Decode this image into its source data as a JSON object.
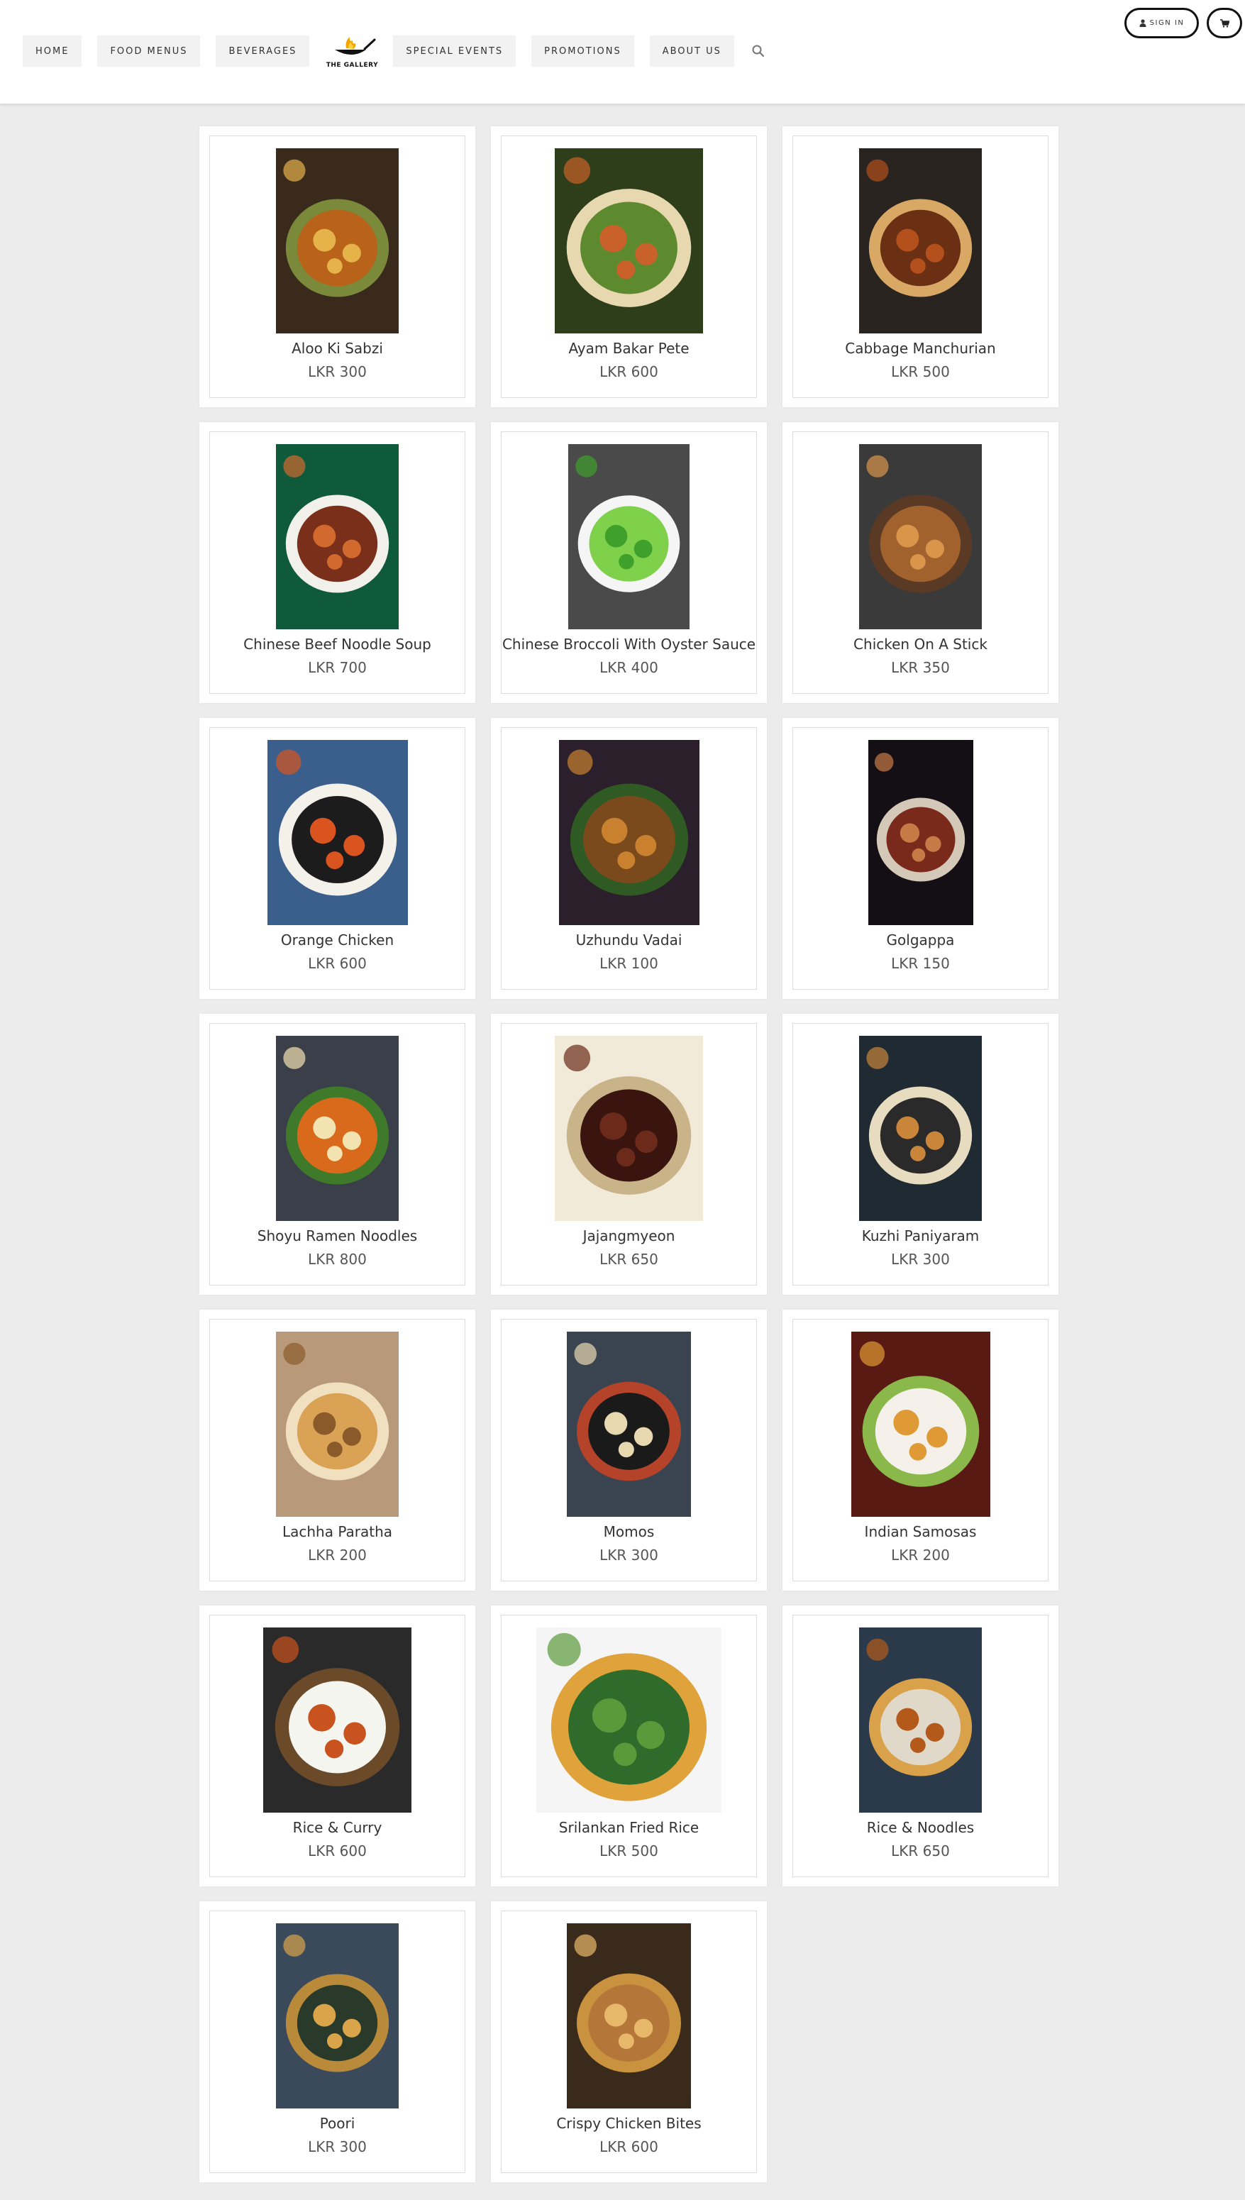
{
  "nav": {
    "items": [
      "HOME",
      "FOOD MENUS",
      "BEVERAGES",
      "SPECIAL EVENTS",
      "PROMOTIONS",
      "ABOUT US"
    ],
    "logo_text": "THE GALLERY",
    "search_icon": "search-icon"
  },
  "account": {
    "signin_label": "SIGN IN",
    "signin_icon": "user-icon",
    "cart_icon": "cart-icon"
  },
  "colors": {
    "background": "#ececec",
    "card": "#ffffff",
    "text": "#333333",
    "logo_accent": "#f0a500"
  },
  "menu_items": [
    {
      "name": "Aloo Ki Sabzi",
      "price": "LKR 300"
    },
    {
      "name": "Ayam Bakar Pete",
      "price": "LKR 600"
    },
    {
      "name": "Cabbage Manchurian",
      "price": "LKR 500"
    },
    {
      "name": "Chinese Beef Noodle Soup",
      "price": "LKR 700"
    },
    {
      "name": "Chinese Broccoli With Oyster Sauce",
      "price": "LKR 400"
    },
    {
      "name": "Chicken On A Stick",
      "price": "LKR 350"
    },
    {
      "name": "Orange Chicken",
      "price": "LKR 600"
    },
    {
      "name": "Uzhundu Vadai",
      "price": "LKR 100"
    },
    {
      "name": "Golgappa",
      "price": "LKR 150"
    },
    {
      "name": "Shoyu Ramen Noodles",
      "price": "LKR 800"
    },
    {
      "name": "Jajangmyeon",
      "price": "LKR 650"
    },
    {
      "name": "Kuzhi Paniyaram",
      "price": "LKR 300"
    },
    {
      "name": "Lachha Paratha",
      "price": "LKR 200"
    },
    {
      "name": "Momos",
      "price": "LKR 300"
    },
    {
      "name": "Indian Samosas",
      "price": "LKR 200"
    },
    {
      "name": "Rice & Curry",
      "price": "LKR 600"
    },
    {
      "name": "Srilankan Fried Rice",
      "price": "LKR 500"
    },
    {
      "name": "Rice & Noodles",
      "price": "LKR 650"
    },
    {
      "name": "Poori",
      "price": "LKR 300"
    },
    {
      "name": "Crispy Chicken Bites",
      "price": "LKR 600"
    }
  ]
}
